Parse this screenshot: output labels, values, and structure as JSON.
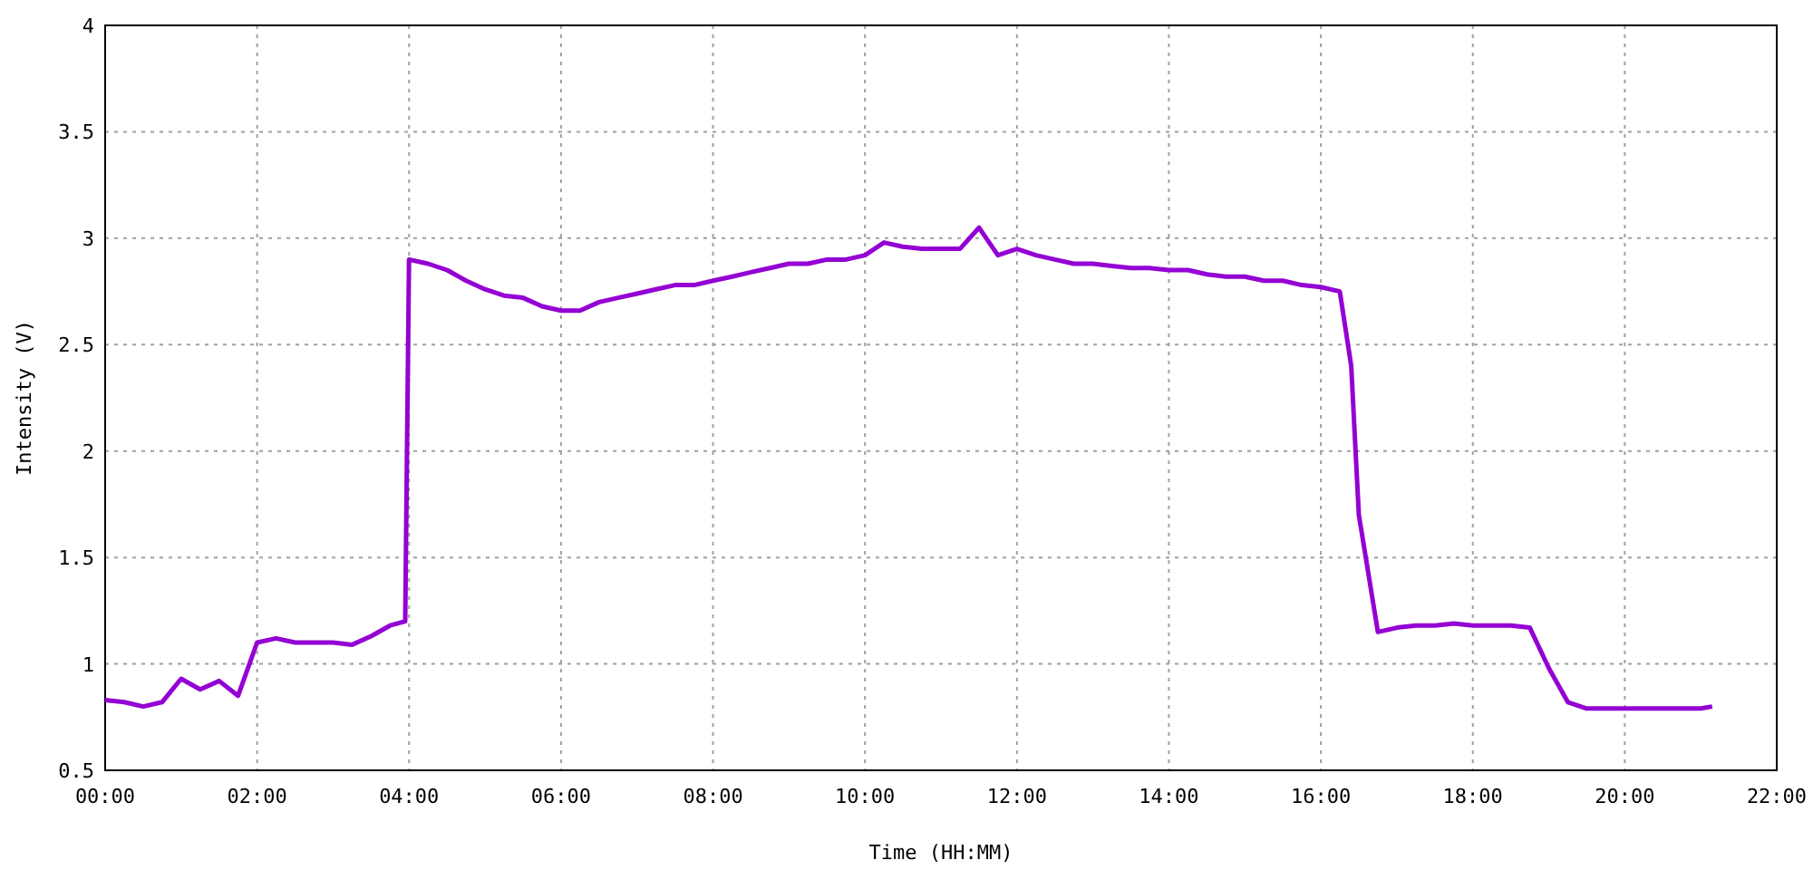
{
  "chart_data": {
    "type": "line",
    "xlabel": "Time (HH:MM)",
    "ylabel": "Intensity (V)",
    "x": [
      0,
      0.25,
      0.5,
      0.75,
      1,
      1.25,
      1.5,
      1.75,
      2,
      2.25,
      2.5,
      2.75,
      3,
      3.25,
      3.5,
      3.75,
      3.95,
      4,
      4.25,
      4.5,
      4.75,
      5,
      5.25,
      5.5,
      5.75,
      6,
      6.25,
      6.5,
      6.75,
      7,
      7.25,
      7.5,
      7.75,
      8,
      8.25,
      8.5,
      8.75,
      9,
      9.25,
      9.5,
      9.75,
      10,
      10.25,
      10.5,
      10.75,
      11,
      11.25,
      11.5,
      11.75,
      12,
      12.25,
      12.5,
      12.75,
      13,
      13.25,
      13.5,
      13.75,
      14,
      14.25,
      14.5,
      14.75,
      15,
      15.25,
      15.5,
      15.75,
      16,
      16.25,
      16.4,
      16.5,
      16.75,
      17,
      17.25,
      17.5,
      17.75,
      18,
      18.25,
      18.5,
      18.75,
      19,
      19.25,
      19.5,
      19.75,
      20,
      20.25,
      20.5,
      20.75,
      21,
      21.15
    ],
    "series": [
      {
        "color": "#9400d3",
        "values": [
          0.83,
          0.82,
          0.8,
          0.82,
          0.93,
          0.88,
          0.92,
          0.85,
          1.1,
          1.12,
          1.1,
          1.1,
          1.1,
          1.09,
          1.13,
          1.18,
          1.2,
          2.9,
          2.88,
          2.85,
          2.8,
          2.76,
          2.73,
          2.72,
          2.68,
          2.66,
          2.66,
          2.7,
          2.72,
          2.74,
          2.76,
          2.78,
          2.78,
          2.8,
          2.82,
          2.84,
          2.86,
          2.88,
          2.88,
          2.9,
          2.9,
          2.92,
          2.98,
          2.96,
          2.95,
          2.95,
          2.95,
          3.05,
          2.92,
          2.95,
          2.92,
          2.9,
          2.88,
          2.88,
          2.87,
          2.86,
          2.86,
          2.85,
          2.85,
          2.83,
          2.82,
          2.82,
          2.8,
          2.8,
          2.78,
          2.77,
          2.75,
          2.4,
          1.7,
          1.15,
          1.17,
          1.18,
          1.18,
          1.19,
          1.18,
          1.18,
          1.18,
          1.17,
          0.98,
          0.82,
          0.79,
          0.79,
          0.79,
          0.79,
          0.79,
          0.79,
          0.79,
          0.8
        ]
      }
    ],
    "grid": true,
    "xlim": [
      0,
      22
    ],
    "ylim": [
      0.5,
      4
    ],
    "xticks": [
      {
        "value": 0,
        "label": "00:00"
      },
      {
        "value": 2,
        "label": "02:00"
      },
      {
        "value": 4,
        "label": "04:00"
      },
      {
        "value": 6,
        "label": "06:00"
      },
      {
        "value": 8,
        "label": "08:00"
      },
      {
        "value": 10,
        "label": "10:00"
      },
      {
        "value": 12,
        "label": "12:00"
      },
      {
        "value": 14,
        "label": "14:00"
      },
      {
        "value": 16,
        "label": "16:00"
      },
      {
        "value": 18,
        "label": "18:00"
      },
      {
        "value": 20,
        "label": "20:00"
      },
      {
        "value": 22,
        "label": "22:00"
      }
    ],
    "yticks": [
      {
        "value": 0.5,
        "label": "0.5"
      },
      {
        "value": 1,
        "label": "1"
      },
      {
        "value": 1.5,
        "label": "1.5"
      },
      {
        "value": 2,
        "label": "2"
      },
      {
        "value": 2.5,
        "label": "2.5"
      },
      {
        "value": 3,
        "label": "3"
      },
      {
        "value": 3.5,
        "label": "3.5"
      },
      {
        "value": 4,
        "label": "4"
      }
    ]
  }
}
